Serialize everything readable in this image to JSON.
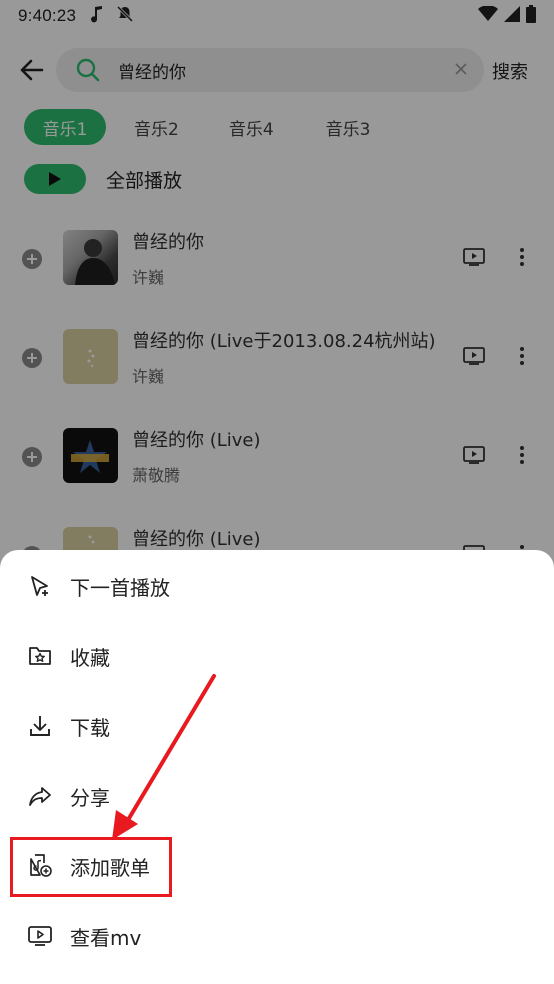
{
  "status_bar": {
    "time": "9:40:23",
    "icons": [
      "music-note-icon",
      "notification-muted-icon",
      "wifi-icon",
      "signal-icon",
      "battery-icon"
    ]
  },
  "search": {
    "query": "曾经的你",
    "submit_label": "搜索"
  },
  "tabs": [
    {
      "label": "音乐1",
      "active": true
    },
    {
      "label": "音乐2",
      "active": false
    },
    {
      "label": "音乐4",
      "active": false
    },
    {
      "label": "音乐3",
      "active": false
    }
  ],
  "play_all": {
    "label": "全部播放"
  },
  "songs": [
    {
      "title": "曾经的你",
      "artist": "许巍"
    },
    {
      "title": "曾经的你 (Live于2013.08.24杭州站)",
      "artist": "许巍"
    },
    {
      "title": "曾经的你 (Live)",
      "artist": "萧敬腾"
    },
    {
      "title": "曾经的你 (Live)",
      "artist": ""
    }
  ],
  "sheet_menu": [
    {
      "label": "下一首播放",
      "icon": "play-next-icon"
    },
    {
      "label": "收藏",
      "icon": "favorite-folder-icon"
    },
    {
      "label": "下载",
      "icon": "download-icon"
    },
    {
      "label": "分享",
      "icon": "share-icon"
    },
    {
      "label": "添加歌单",
      "icon": "add-to-playlist-icon"
    },
    {
      "label": "查看mv",
      "icon": "mv-icon"
    }
  ],
  "colors": {
    "accent": "#2dbd6e",
    "highlight": "#e8191f"
  }
}
